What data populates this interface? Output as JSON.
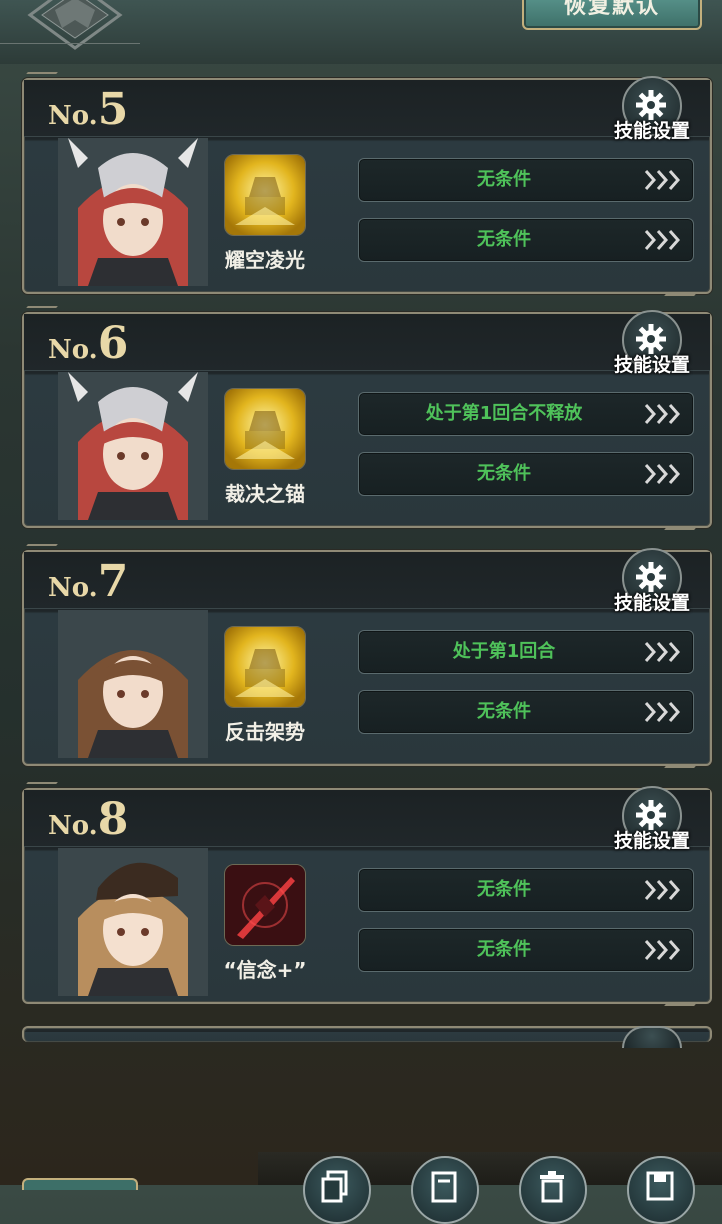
{
  "header": {
    "restore_label": "恢复默认"
  },
  "cards": [
    {
      "no_prefix": "No.",
      "no": "5",
      "settings_label": "技能设置",
      "skill_name": "耀空凌光",
      "conditions": [
        "无条件",
        "无条件"
      ]
    },
    {
      "no_prefix": "No.",
      "no": "6",
      "settings_label": "技能设置",
      "skill_name": "裁决之锚",
      "conditions": [
        "处于第1回合不释放",
        "无条件"
      ]
    },
    {
      "no_prefix": "No.",
      "no": "7",
      "settings_label": "技能设置",
      "skill_name": "反击架势",
      "conditions": [
        "处于第1回合",
        "无条件"
      ]
    },
    {
      "no_prefix": "No.",
      "no": "8",
      "settings_label": "技能设置",
      "skill_name": "“信念+”",
      "conditions": [
        "无条件",
        "无条件"
      ]
    }
  ],
  "icons": [
    "gear-icon",
    "triple-chevron-icon",
    "copy-icon",
    "document-icon",
    "trash-icon",
    "save-icon"
  ],
  "colors": {
    "condition_text": "#4fc25a",
    "number_gold": "#e8d8a8",
    "accent_teal": "#4a8a82"
  }
}
